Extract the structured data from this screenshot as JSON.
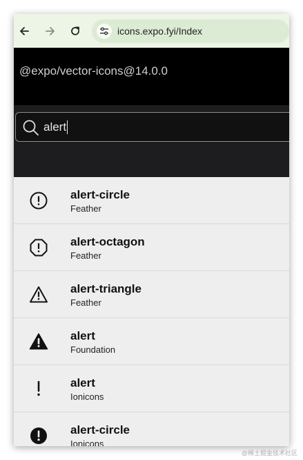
{
  "browser": {
    "url": "icons.expo.fyi/Index",
    "back_icon": "arrow-left-icon",
    "forward_icon": "arrow-right-icon",
    "reload_icon": "reload-icon",
    "site_info_icon": "tune-icon"
  },
  "header": {
    "title": "@expo/vector-icons@14.0.0"
  },
  "search": {
    "value": "alert",
    "icon": "search-icon"
  },
  "results": [
    {
      "name": "alert-circle",
      "family": "Feather",
      "icon": "alert-circle-outline-icon"
    },
    {
      "name": "alert-octagon",
      "family": "Feather",
      "icon": "alert-octagon-outline-icon"
    },
    {
      "name": "alert-triangle",
      "family": "Feather",
      "icon": "alert-triangle-outline-icon"
    },
    {
      "name": "alert",
      "family": "Foundation",
      "icon": "alert-triangle-filled-icon"
    },
    {
      "name": "alert",
      "family": "Ionicons",
      "icon": "exclamation-icon"
    },
    {
      "name": "alert-circle",
      "family": "Ionicons",
      "icon": "alert-circle-filled-icon"
    }
  ],
  "watermark": "@稀土掘金技术社区",
  "colors": {
    "toolbar": "#edf5e6",
    "url_pill": "#dcebd3",
    "header_bg": "#000000",
    "search_bg": "#1d1d1f",
    "list_bg": "#eeeeee"
  }
}
